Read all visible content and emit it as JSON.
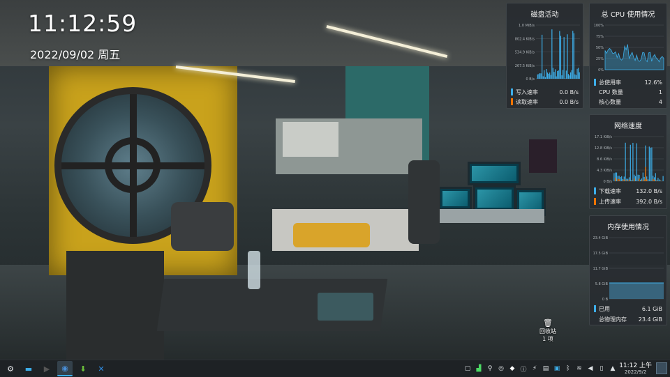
{
  "desktop_clock": {
    "time": "11:12:59",
    "date": "2022/09/02 周五"
  },
  "widgets": {
    "disk": {
      "title": "磁盘活动",
      "y_ticks": [
        "1.0 MiB/s",
        "802.4 KiB/s",
        "534.9 KiB/s",
        "267.5 KiB/s",
        "0 B/s"
      ],
      "rows": [
        {
          "label": "写入速率",
          "value": "0.0 B/s",
          "color": "#3daee9"
        },
        {
          "label": "读取速率",
          "value": "0.0 B/s",
          "color": "#f67400"
        }
      ]
    },
    "cpu": {
      "title": "总 CPU 使用情况",
      "y_ticks": [
        "100%",
        "75%",
        "50%",
        "25%",
        "0%"
      ],
      "rows": [
        {
          "label": "总使用率",
          "value": "12.6%",
          "color": "#3daee9"
        },
        {
          "label": "CPU 数量",
          "value": "1"
        },
        {
          "label": "核心数量",
          "value": "4"
        }
      ]
    },
    "network": {
      "title": "网络速度",
      "y_ticks": [
        "17.1 KiB/s",
        "12.8 KiB/s",
        "8.6 KiB/s",
        "4.3 KiB/s",
        "0 B/s"
      ],
      "rows": [
        {
          "label": "下载速率",
          "value": "132.0 B/s",
          "color": "#3daee9"
        },
        {
          "label": "上传速率",
          "value": "392.0 B/s",
          "color": "#f67400"
        }
      ]
    },
    "memory": {
      "title": "内存使用情况",
      "y_ticks": [
        "23.4 GiB",
        "17.5 GiB",
        "11.7 GiB",
        "5.8 GiB",
        "0 B"
      ],
      "rows": [
        {
          "label": "已用",
          "value": "6.1 GiB",
          "color": "#3daee9"
        },
        {
          "label": "总物理内存",
          "value": "23.4 GiB"
        }
      ]
    }
  },
  "trash": {
    "icon": "trash-icon",
    "label": "回收站",
    "count": "1 项"
  },
  "taskbar": {
    "launchers": [
      {
        "name": "app-launcher",
        "icon": "kde-launcher-icon",
        "glyph": "⚙"
      },
      {
        "name": "file-manager",
        "icon": "folder-icon",
        "glyph": "▬",
        "color": "#3daee9"
      },
      {
        "name": "terminal",
        "icon": "terminal-icon",
        "glyph": "▶",
        "color": "#555"
      },
      {
        "name": "chromium",
        "icon": "chromium-icon",
        "glyph": "◉",
        "color": "#4a90d9",
        "active": true
      },
      {
        "name": "update-manager",
        "icon": "update-icon",
        "glyph": "⬇",
        "color": "#6bbf3a"
      },
      {
        "name": "vscode",
        "icon": "vscode-icon",
        "glyph": "✕",
        "color": "#2f8de4"
      }
    ],
    "tray": [
      "window-icon",
      "system-monitor-icon",
      "network-manager-icon",
      "settings-icon",
      "security-icon",
      "info-icon",
      "usb-icon",
      "clipboard-icon",
      "dropbox-icon",
      "bluetooth-icon",
      "wifi-icon",
      "volume-icon",
      "battery-icon",
      "chevron-up-icon"
    ],
    "tray_glyphs": [
      "▢",
      "▟",
      "⚲",
      "◎",
      "◆",
      "ⓘ",
      "⚡",
      "▤",
      "▣",
      "ᛒ",
      "≋",
      "◀",
      "▯",
      "▲"
    ],
    "clock_time": "11:12 上午",
    "clock_date": "2022/9/2"
  }
}
